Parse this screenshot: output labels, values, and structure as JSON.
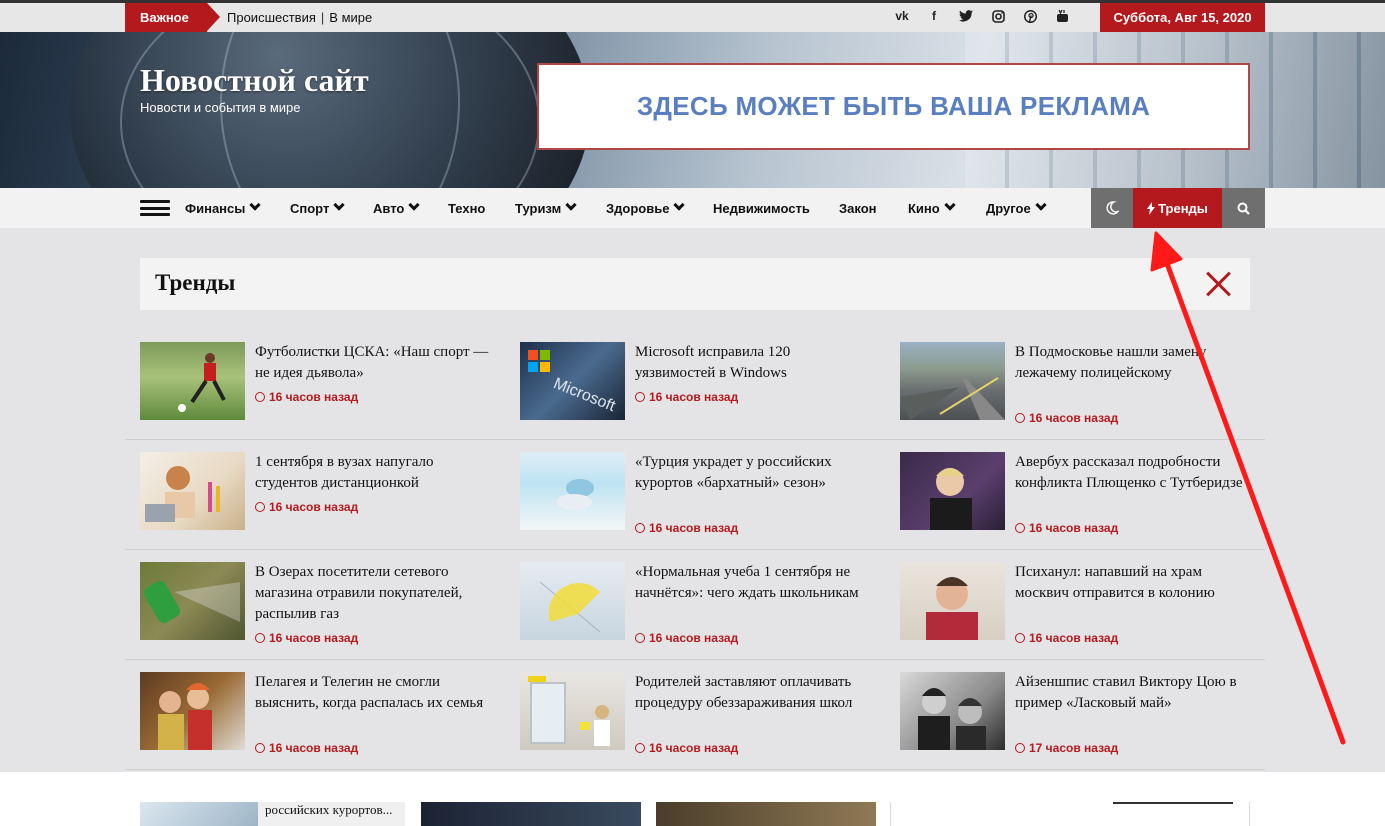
{
  "topbar": {
    "badge": "Важное",
    "links": [
      "Происшествия",
      "В мире"
    ],
    "social_icons": [
      "vk-icon",
      "facebook-icon",
      "twitter-icon",
      "instagram-icon",
      "pinterest-icon",
      "youtube-icon"
    ],
    "date": "Суббота, Авг 15, 2020"
  },
  "header": {
    "site_title": "Новостной сайт",
    "tagline": "Новости и события в мире",
    "ad_text": "ЗДЕСЬ МОЖЕТ БЫТЬ ВАША РЕКЛАМА"
  },
  "nav": {
    "items": [
      {
        "label": "Финансы",
        "dropdown": true
      },
      {
        "label": "Спорт",
        "dropdown": true
      },
      {
        "label": "Авто",
        "dropdown": true
      },
      {
        "label": "Техно",
        "dropdown": false
      },
      {
        "label": "Туризм",
        "dropdown": true
      },
      {
        "label": "Здоровье",
        "dropdown": true
      },
      {
        "label": "Недвижимость",
        "dropdown": false
      },
      {
        "label": "Закон",
        "dropdown": false
      },
      {
        "label": "Кино",
        "dropdown": true
      },
      {
        "label": "Другое",
        "dropdown": true
      }
    ],
    "trends_label": "Тренды"
  },
  "trends": {
    "title": "Тренды",
    "rows": [
      [
        {
          "title": "Футболистки ЦСКА: «Наш спорт — не идея дьявола»",
          "time": "16 часов назад"
        },
        {
          "title": "Microsoft исправила 120 уязвимостей в Windows",
          "time": "16 часов назад"
        },
        {
          "title": "В Подмосковье нашли замену лежачему полицейскому",
          "time": "16 часов назад"
        }
      ],
      [
        {
          "title": "1 сентября в вузах напугало студентов дистанционкой",
          "time": "16 часов назад"
        },
        {
          "title": "«Турция украдет у российских курортов «бархатный» сезон»",
          "time": "16 часов назад"
        },
        {
          "title": "Авербух рассказал подробности конфликта Плющенко с Тутберидзе",
          "time": "16 часов назад"
        }
      ],
      [
        {
          "title": "В Озерах посетители сетевого магазина отравили покупателей, распылив газ",
          "time": "16 часов назад"
        },
        {
          "title": "«Нормальная учеба 1 сентября не начнётся»: чего ждать школьникам",
          "time": "16 часов назад"
        },
        {
          "title": "Психанул: напавший на храм москвич отправится в колонию",
          "time": "16 часов назад"
        }
      ],
      [
        {
          "title": "Пелагея и Телегин не смогли выяснить, когда распалась их семья",
          "time": "16 часов назад"
        },
        {
          "title": "Родителей заставляют оплачивать процедуру обеззараживания школ",
          "time": "16 часов назад"
        },
        {
          "title": "Айзеншпис ставил Виктору Цою в пример «Ласковый май»",
          "time": "17 часов назад"
        }
      ]
    ]
  },
  "below": {
    "partial_text": "российских курортов..."
  },
  "colors": {
    "accent": "#b3191d",
    "nav_bg": "#f2f2f2",
    "panel_bg": "#e4e4e6",
    "annotation_arrow": "#ff1a1a"
  }
}
